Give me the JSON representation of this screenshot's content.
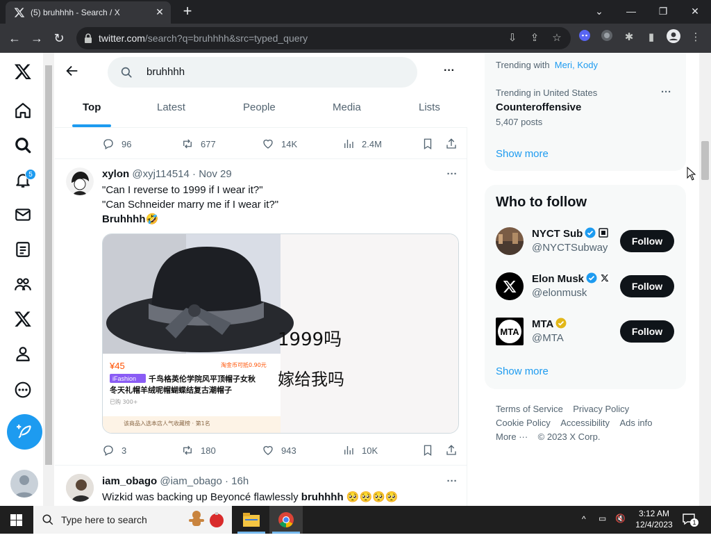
{
  "browser": {
    "tab_title": "(5) bruhhhh - Search / X",
    "url_domain": "twitter.com",
    "url_path": "/search?q=bruhhhh&src=typed_query"
  },
  "nav": {
    "notification_count": "5"
  },
  "search": {
    "query": "bruhhhh"
  },
  "tabs": [
    "Top",
    "Latest",
    "People",
    "Media",
    "Lists"
  ],
  "prev_tweet_stats": {
    "replies": "96",
    "reposts": "677",
    "likes": "14K",
    "views": "2.4M"
  },
  "tweet1": {
    "name": "xylon",
    "handle": "@xyj114514",
    "date": "· Nov 29",
    "line1": "\"Can I reverse to 1999 if I wear it?\"",
    "line2": "\"Can Schneider marry me if I wear it?\"",
    "line3": "Bruhhhh🤣",
    "media": {
      "price": "¥45",
      "tag": "iFashion",
      "title1": "千鸟格英伦学院风平顶帽子女秋",
      "title2": "冬天礼帽羊绒呢帽蝴蝶结复古潮帽子",
      "sold": "已购 300+",
      "rank": "该商品入选本店人气收藏榜 · 第1名",
      "price_right": "淘金币可抵0.90元",
      "big1": "1999吗",
      "big2": "嫁给我吗"
    },
    "stats": {
      "replies": "3",
      "reposts": "180",
      "likes": "943",
      "views": "10K"
    }
  },
  "tweet2": {
    "name": "iam_obago",
    "handle": "@iam_obago",
    "date": "· 16h",
    "text": "Wizkid was backing up Beyoncé flawlessly ",
    "bold": "bruhhhh",
    "emoji": " 🥺🥺🥺🥺"
  },
  "trending": {
    "with_label": "Trending with",
    "with_1": "Meri",
    "with_sep": ", ",
    "with_2": "Kody",
    "location": "Trending in United States",
    "topic": "Counteroffensive",
    "posts": "5,407 posts",
    "show_more": "Show more"
  },
  "who_to_follow": {
    "title": "Who to follow",
    "accounts": [
      {
        "name": "NYCT Sub",
        "handle": "@NYCTSubway",
        "button": "Follow"
      },
      {
        "name": "Elon Musk",
        "handle": "@elonmusk",
        "button": "Follow"
      },
      {
        "name": "MTA",
        "handle": "@MTA",
        "button": "Follow"
      }
    ],
    "show_more": "Show more"
  },
  "footer": {
    "links": [
      "Terms of Service",
      "Privacy Policy",
      "Cookie Policy",
      "Accessibility",
      "Ads info",
      "More ···"
    ],
    "copyright": "© 2023 X Corp."
  },
  "taskbar": {
    "search_placeholder": "Type here to search",
    "time": "3:12 AM",
    "date": "12/4/2023",
    "notifications": "1"
  },
  "colors": {
    "accent": "#1d9bf0",
    "text": "#0f1419",
    "muted": "#536471",
    "gold": "#e2b719"
  }
}
